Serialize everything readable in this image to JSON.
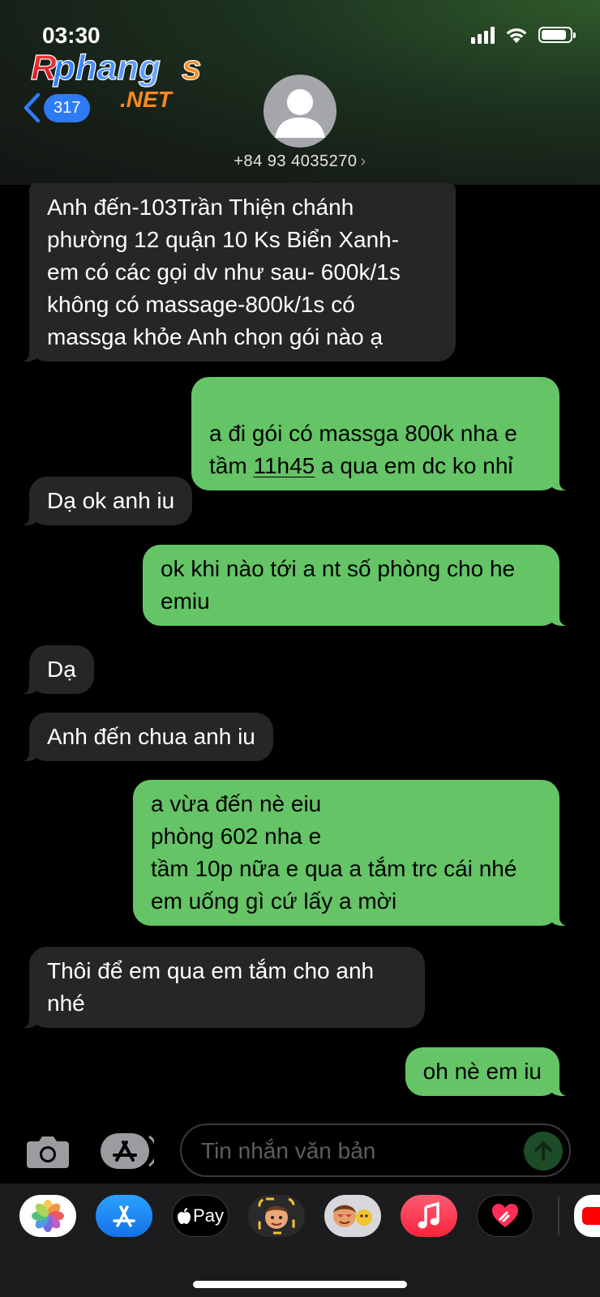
{
  "status": {
    "time": "03:30"
  },
  "watermark": {
    "line1": "Rphangs",
    "line2": ".NET"
  },
  "nav": {
    "unread_count": "317"
  },
  "contact": {
    "phone": "+84 93 4035270",
    "chevron": "›"
  },
  "messages": [
    {
      "from": "them",
      "text": "Anh đến-103Trần Thiện chánh\nphường 12 quận 10 Ks Biển Xanh-\nem có các gọi dv như sau- 600k/1s\nkhông có massage-800k/1s có\nmassga khỏe Anh chọn gói nào ạ"
    },
    {
      "from": "me",
      "line1": "a đi gói có massga 800k nha e",
      "pre": "tầm ",
      "link": "11h45",
      "post": " a qua em dc ko nhỉ"
    },
    {
      "from": "them",
      "text": "Dạ ok anh iu"
    },
    {
      "from": "me",
      "text": "ok khi nào tới a nt số phòng cho he\nemiu"
    },
    {
      "from": "them",
      "text": "Dạ"
    },
    {
      "from": "them",
      "text": "Anh đến chua anh iu"
    },
    {
      "from": "me",
      "text": "a vừa đến nè eiu\nphòng 602 nha e\ntầm 10p nữa e qua a tắm trc cái nhé\nem uống gì cứ lấy a mời"
    },
    {
      "from": "them",
      "text": "Thôi để em qua em tắm cho anh\nnhé"
    },
    {
      "from": "me",
      "text": "oh nè em iu"
    }
  ],
  "input": {
    "placeholder": "Tin nhắn văn bản"
  },
  "apps": [
    {
      "name": "photos-icon"
    },
    {
      "name": "app-store-icon"
    },
    {
      "name": "apple-pay-icon",
      "label": "Pay"
    },
    {
      "name": "memoji-icon"
    },
    {
      "name": "memoji-stickers-icon"
    },
    {
      "name": "music-icon"
    },
    {
      "name": "digital-touch-icon"
    }
  ],
  "colors": {
    "incoming": "#262628",
    "outgoing": "#65c466",
    "badge": "#2f7bf6"
  }
}
